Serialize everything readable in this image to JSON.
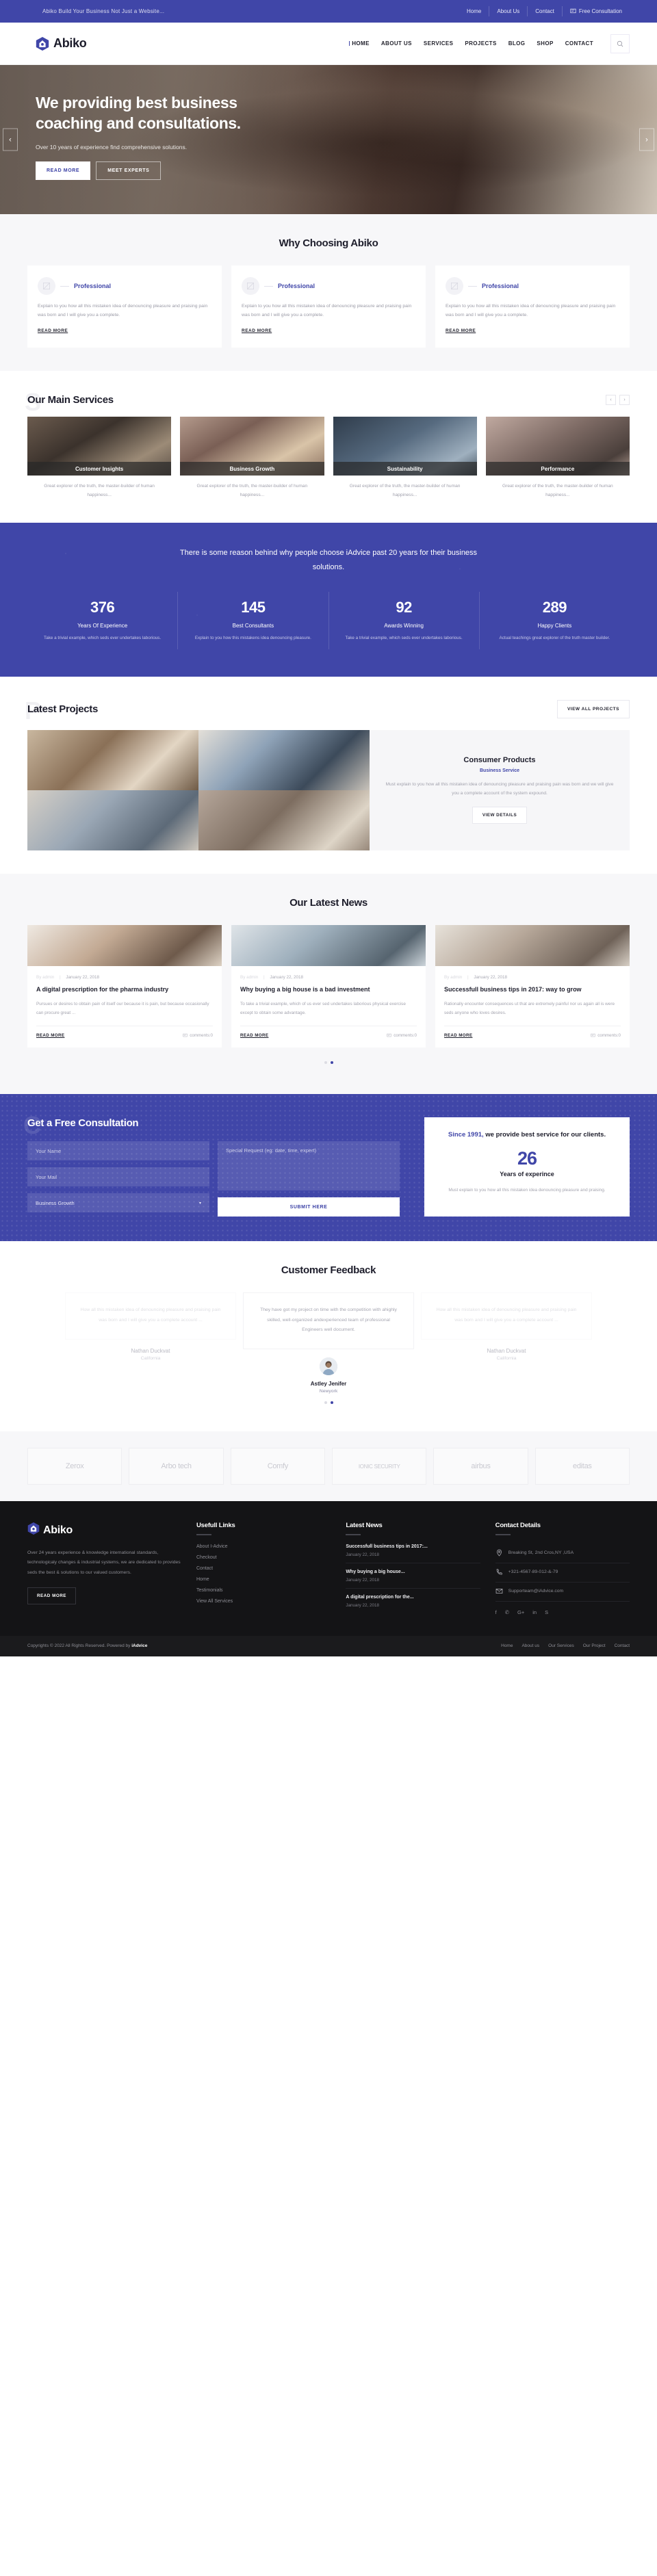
{
  "topbar": {
    "tagline": "Abiko Build Your Business Not Just a Website...",
    "links": [
      "Home",
      "About Us",
      "Contact"
    ],
    "cta": "Free Consultation",
    "cta_icon": "chat-icon"
  },
  "header": {
    "brand": "Abiko",
    "brand_icon": "hexagon-home-logo",
    "nav": [
      "HOME",
      "ABOUT US",
      "SERVICES",
      "PROJECTS",
      "BLOG",
      "SHOP",
      "CONTACT"
    ],
    "active_nav": "HOME",
    "search_icon": "search-icon"
  },
  "hero": {
    "title": "We providing best business coaching and consultations.",
    "subtitle": "Over 10 years of experience find comprehensive solutions.",
    "btn_primary": "READ MORE",
    "btn_secondary": "MEET EXPERTS",
    "prev_icon": "chevron-left-icon",
    "next_icon": "chevron-right-icon"
  },
  "why": {
    "title": "Why Choosing Abiko",
    "ghost": "W",
    "cards": [
      {
        "icon": "pen-square-icon",
        "title": "Professional",
        "body": "Explain to you how all this mistaken idea of denouncing pleasure and praising pain was born and I will give you a complete.",
        "link": "READ MORE"
      },
      {
        "icon": "pen-square-icon",
        "title": "Professional",
        "body": "Explain to you how all this mistaken idea of denouncing pleasure and praising pain was born and I will give you a complete.",
        "link": "READ MORE"
      },
      {
        "icon": "pen-square-icon",
        "title": "Professional",
        "body": "Explain to you how all this mistaken idea of denouncing pleasure and praising pain was born and I will give you a complete.",
        "link": "READ MORE"
      }
    ]
  },
  "services": {
    "title": "Our Main Services",
    "ghost": "S",
    "prev_icon": "chevron-left-icon",
    "next_icon": "chevron-right-icon",
    "items": [
      {
        "caption": "Customer Insights",
        "text": "Great explorer of the truth, the master-builder of human happiness..."
      },
      {
        "caption": "Business Growth",
        "text": "Great explorer of the truth, the master-builder of human happiness..."
      },
      {
        "caption": "Sustainability",
        "text": "Great explorer of the truth, the master-builder of human happiness..."
      },
      {
        "caption": "Performance",
        "text": "Great explorer of the truth, the master-builder of human happiness..."
      }
    ]
  },
  "counters": {
    "heading": "There is some reason behind why people choose iAdvice past 20 years for their business solutions.",
    "items": [
      {
        "num": "376",
        "label": "Years Of Experience",
        "sub": "Take a trivial example, which seds ever undertakes laborious."
      },
      {
        "num": "145",
        "label": "Best Consultants",
        "sub": "Explain to you how this mistakens idea denouncing pleasure."
      },
      {
        "num": "92",
        "label": "Awards Winning",
        "sub": "Take a trivial example, which seds ever undertakes laborious."
      },
      {
        "num": "289",
        "label": "Happy Clients",
        "sub": "Actual teachings great explorer of the truth master builder."
      }
    ]
  },
  "projects": {
    "title": "Latest Projects",
    "ghost": "P",
    "view_all": "VIEW ALL PROJECTS",
    "featured": {
      "name": "Consumer Products",
      "category": "Business Service",
      "description": "Must explain to you how all this mistaken idea of denouncing pleasure and praising pain was born and we will give you a complete account of the system expound.",
      "button": "VIEW DETAILS"
    }
  },
  "news": {
    "title": "Our Latest News",
    "ghost": "N",
    "posts": [
      {
        "author": "By admin",
        "date": "January 22, 2018",
        "title": "A digital prescription for the pharma industry",
        "excerpt": "Pursues or desires to obtain pain of itself our because it is pain, but because occasionally can procure great ...",
        "read_more": "READ MORE",
        "comments": "comments:0"
      },
      {
        "author": "By admin",
        "date": "January 22, 2018",
        "title": "Why buying a big house is a bad investment",
        "excerpt": "To take a trivial example, which of us ever sed undertakes laborious physical exercise except to obtain some advantage.",
        "read_more": "READ MORE",
        "comments": "comments:0"
      },
      {
        "author": "By admin",
        "date": "January 22, 2018",
        "title": "Successfull business tips in 2017: way to grow",
        "excerpt": "Rationally encounter consequences ut that are extremely painful nor us again all is were seds anyone who loves desires.",
        "read_more": "READ MORE",
        "comments": "comments:0"
      }
    ],
    "dots": 2,
    "active_dot": 1
  },
  "consult": {
    "title": "Get a Free Consultation",
    "ghost": "C",
    "name_placeholder": "Your Name",
    "mail_placeholder": "Your Mail",
    "select_value": "Business Growth",
    "select_icon": "chevron-down-icon",
    "request_placeholder": "Special Request (eg: date, time, expert)",
    "submit": "SUBMIT HERE",
    "card": {
      "highlight": "Since 1991,",
      "headline": " we provide best service for our clients.",
      "number": "26",
      "number_label": "Years of experince",
      "text": "Must explain to you how all this mistaken idea denouncing pleasure and praising."
    }
  },
  "feedback": {
    "title": "Customer Feedback",
    "ghost": "F",
    "items": [
      {
        "quote": "How all this mistaken idea of denouncing pleasure and praising pain was born and I will give you a complete account ...",
        "name": "Nathan Duckvat",
        "location": "California"
      },
      {
        "quote": "They have got my project on time with the competition with ahighly skilled, well-organized andexperienced team of professional Engineers well document.",
        "name": "Astley Jenifer",
        "location": "Newyork"
      },
      {
        "quote": "How all this mistaken idea of denouncing pleasure and praising pain was born and I will give you a complete account ...",
        "name": "Nathan Duckvat",
        "location": "California"
      }
    ],
    "dots": 2,
    "active_dot": 1
  },
  "clients": [
    "Zerox",
    "Arbo tech",
    "Comfy",
    "IONIC SECURITY",
    "airbus",
    "editas"
  ],
  "footer": {
    "brand": "Abiko",
    "about": "Over 24 years experience & knowledge international standards, technologicaly changes & industrial systems, we are dedicated to provides seds the best & solutions to our valued customers.",
    "read_more": "READ MORE",
    "useful_links_title": "Usefull Links",
    "useful_links": [
      "About I-Advice",
      "Checkout",
      "Contact",
      "Home",
      "Testimonials",
      "View All Services"
    ],
    "latest_news_title": "Latest News",
    "latest_news": [
      {
        "title": "Successfull business tips in 2017:...",
        "date": "January 22, 2018"
      },
      {
        "title": "Why buying a big house...",
        "date": "January 22, 2018"
      },
      {
        "title": "A digital prescription for the...",
        "date": "January 22, 2018"
      }
    ],
    "contact_title": "Contact Details",
    "contact": [
      {
        "icon": "location-pin-icon",
        "text": "Breaking St, 2nd Cros,NY ,USA"
      },
      {
        "icon": "phone-icon",
        "text": "+321-4567-89-012-&-79"
      },
      {
        "icon": "envelope-icon",
        "text": "Supporteam@iAdvice.com"
      }
    ],
    "social": [
      "facebook-icon",
      "twitter-icon",
      "google-plus-icon",
      "linkedin-icon",
      "skype-icon"
    ],
    "social_glyphs": [
      "f",
      "✆",
      "G+",
      "in",
      "S"
    ]
  },
  "copyright": {
    "text": "Copyrights © 2022 All Rights Reserved. Powered by ",
    "brand": "iAdvice",
    "links": [
      "Home",
      "About us",
      "Our Services",
      "Our Project",
      "Contact"
    ]
  },
  "colors": {
    "brand": "#4046a8",
    "dark": "#141416",
    "muted": "#a4a4af"
  }
}
